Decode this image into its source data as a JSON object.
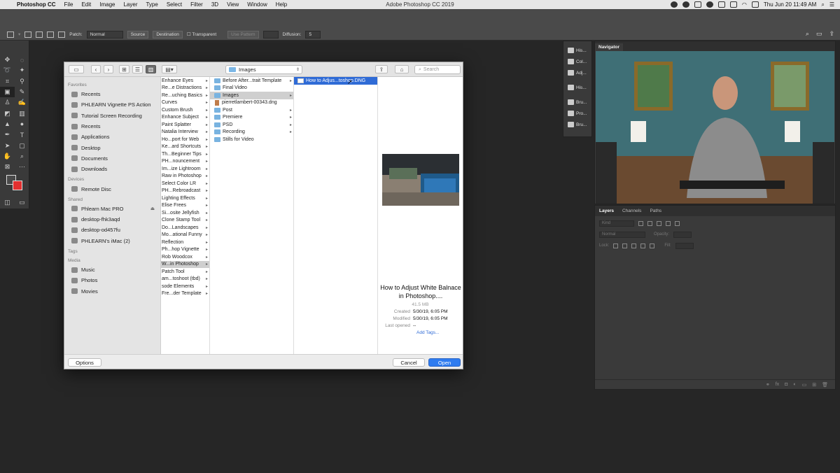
{
  "menubar": {
    "apple": "",
    "items": [
      "Photoshop CC",
      "File",
      "Edit",
      "Image",
      "Layer",
      "Type",
      "Select",
      "Filter",
      "3D",
      "View",
      "Window",
      "Help"
    ],
    "window_title": "Adobe Photoshop CC 2019",
    "clock": "Thu Jun 20  11:49 AM"
  },
  "options_bar": {
    "patch_label": "Patch:",
    "patch_mode": "Normal",
    "source": "Source",
    "destination": "Destination",
    "transparent": "Transparent",
    "use_pattern": "Use Pattern",
    "diffusion_label": "Diffusion:",
    "diffusion_value": "5"
  },
  "dock": [
    "His...",
    "Col...",
    "Adj...",
    "His...",
    "Bru...",
    "Pro...",
    "Bru..."
  ],
  "navigator": {
    "tab": "Navigator"
  },
  "layers": {
    "tabs": [
      "Layers",
      "Channels",
      "Paths"
    ],
    "kind": "Kind",
    "blend": "Normal",
    "opacity_label": "Opacity:",
    "lock_label": "Lock:",
    "fill_label": "Fill:"
  },
  "dialog": {
    "location": "Images",
    "search_placeholder": "Search",
    "sidebar": {
      "favorites_title": "Favorites",
      "favorites": [
        "Recents",
        "PHLEARN Vignette PS Action",
        "Tutorial Screen Recording",
        "Recents",
        "Applications",
        "Desktop",
        "Documents",
        "Downloads"
      ],
      "devices_title": "Devices",
      "devices": [
        "Remote Disc"
      ],
      "shared_title": "Shared",
      "shared": [
        "Phlearn Mac PRO",
        "desktop-fhk3aqd",
        "desktop-od457fu",
        "PHLEARN's iMac (2)"
      ],
      "tags_title": "Tags",
      "media_title": "Media",
      "media": [
        "Music",
        "Photos",
        "Movies"
      ]
    },
    "col1": [
      "Enhance Eyes",
      "Re...e Distractions",
      "Re...uching Basics",
      "Curves",
      "Custom Brush",
      "Enhance Subject",
      "Paint Splatter",
      "Natalia Interview",
      "Ho...port for Web",
      "Ke...ard Shortcuts",
      "Th...Beginner Tips",
      "PH...nouncement",
      "Im...ize Lightroom",
      "Raw in Photoshop",
      "Select Color LR",
      "PH...Rebroadcast",
      "Lighting Effects",
      "Elise Frees",
      "Si...osite Jellyfish",
      "Clone Stamp Tool",
      "Do...Landscapes",
      "Mo...ational Funny",
      "Reflection",
      "Ph...hop Vignette",
      "Rob Woodcox",
      "W...in Photoshop",
      "Patch Tool",
      "am...toshoot (tbd)",
      "sode Elements",
      "Fre...der Template"
    ],
    "col2": [
      "Before After...trait Template",
      "Final Video",
      "Images",
      "pierretlambert-00343.dng",
      "Post",
      "Premiere",
      "PSD",
      "Recording",
      "Stills for Video"
    ],
    "col3": [
      "How to Adjus...toshop.DNG"
    ],
    "preview": {
      "name": "How to Adjust White Balnace in Photoshop....",
      "size": "41.5 MB",
      "created_label": "Created",
      "created": "5/30/19, 6:05 PM",
      "modified_label": "Modified",
      "modified": "5/30/19, 6:05 PM",
      "last_opened_label": "Last opened",
      "last_opened": "--",
      "add_tags": "Add Tags..."
    },
    "options_btn": "Options",
    "cancel_btn": "Cancel",
    "open_btn": "Open"
  }
}
